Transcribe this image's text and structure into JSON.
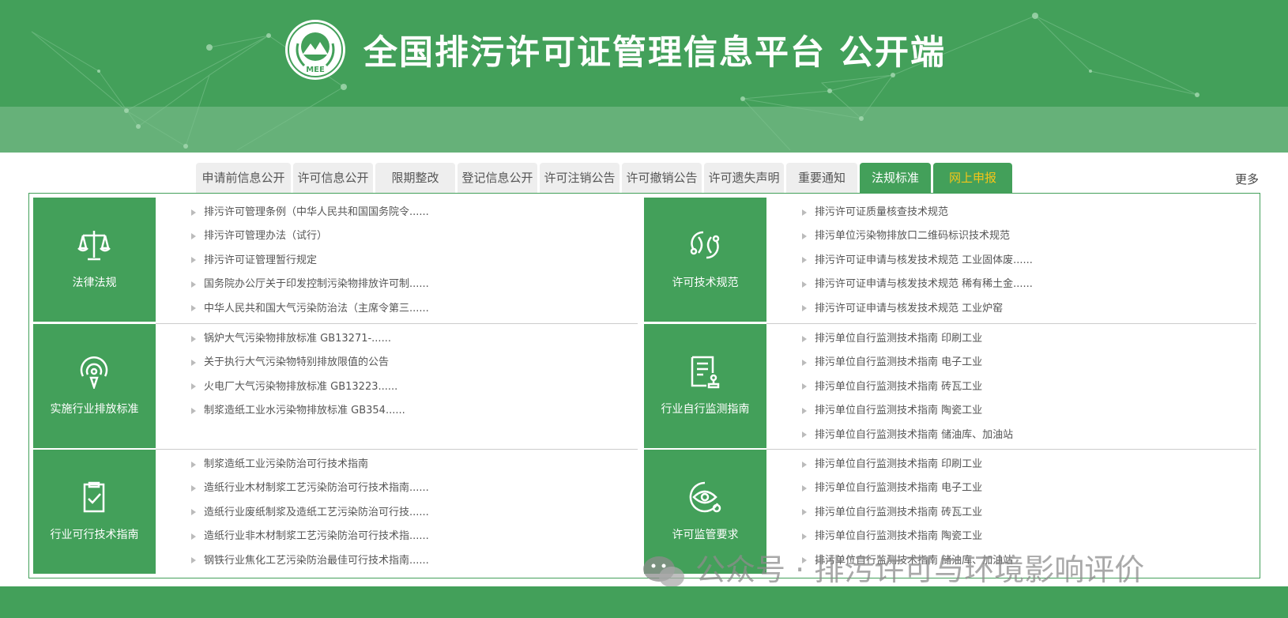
{
  "header": {
    "title": "全国排污许可证管理信息平台  公开端",
    "logo_text": "MEE",
    "bg_color": "#43a05a"
  },
  "tabs": [
    {
      "label": "申请前信息公开"
    },
    {
      "label": "许可信息公开"
    },
    {
      "label": "限期整改"
    },
    {
      "label": "登记信息公开"
    },
    {
      "label": "许可注销公告"
    },
    {
      "label": "许可撤销公告"
    },
    {
      "label": "许可遗失声明"
    },
    {
      "label": "重要通知"
    },
    {
      "label": "法规标准",
      "state": "active"
    },
    {
      "label": "网上申报",
      "state": "highlight"
    }
  ],
  "more_label": "更多",
  "sections": [
    {
      "category": "法律法规",
      "icon": "scales-icon",
      "items": [
        "排污许可管理条例（中华人民共和国国务院令......",
        "排污许可管理办法（试行）",
        "排污许可证管理暂行规定",
        "国务院办公厅关于印发控制污染物排放许可制......",
        "中华人民共和国大气污染防治法（主席令第三......"
      ]
    },
    {
      "category": "许可技术规范",
      "icon": "link-icon",
      "items": [
        "排污许可证质量核查技术规范",
        "排污单位污染物排放口二维码标识技术规范",
        "排污许可证申请与核发技术规范 工业固体废......",
        "排污许可证申请与核发技术规范 稀有稀土金......",
        "排污许可证申请与核发技术规范 工业炉窑"
      ]
    },
    {
      "category": "实施行业排放标准",
      "icon": "signal-pin-icon",
      "items": [
        "锅炉大气污染物排放标准 GB13271-......",
        "关于执行大气污染物特别排放限值的公告",
        "火电厂大气污染物排放标准 GB13223......",
        "制浆造纸工业水污染物排放标准 GB354......"
      ]
    },
    {
      "category": "行业自行监测指南",
      "icon": "document-stamp-icon",
      "items": [
        "排污单位自行监测技术指南 印刷工业",
        "排污单位自行监测技术指南 电子工业",
        "排污单位自行监测技术指南 砖瓦工业",
        "排污单位自行监测技术指南 陶瓷工业",
        "排污单位自行监测技术指南 储油库、加油站"
      ]
    },
    {
      "category": "行业可行技术指南",
      "icon": "clipboard-check-icon",
      "items": [
        "制浆造纸工业污染防治可行技术指南",
        "造纸行业木材制浆工艺污染防治可行技术指南......",
        "造纸行业废纸制浆及造纸工艺污染防治可行技......",
        "造纸行业非木材制浆工艺污染防治可行技术指......",
        "钢铁行业焦化工艺污染防治最佳可行技术指南......"
      ]
    },
    {
      "category": "许可监管要求",
      "icon": "eye-check-icon",
      "items": [
        "排污单位自行监测技术指南 印刷工业",
        "排污单位自行监测技术指南 电子工业",
        "排污单位自行监测技术指南 砖瓦工业",
        "排污单位自行监测技术指南 陶瓷工业",
        "排污单位自行监测技术指南 储油库、加油站"
      ]
    }
  ],
  "watermark": "公众号 · 排污许可与环境影响评价"
}
